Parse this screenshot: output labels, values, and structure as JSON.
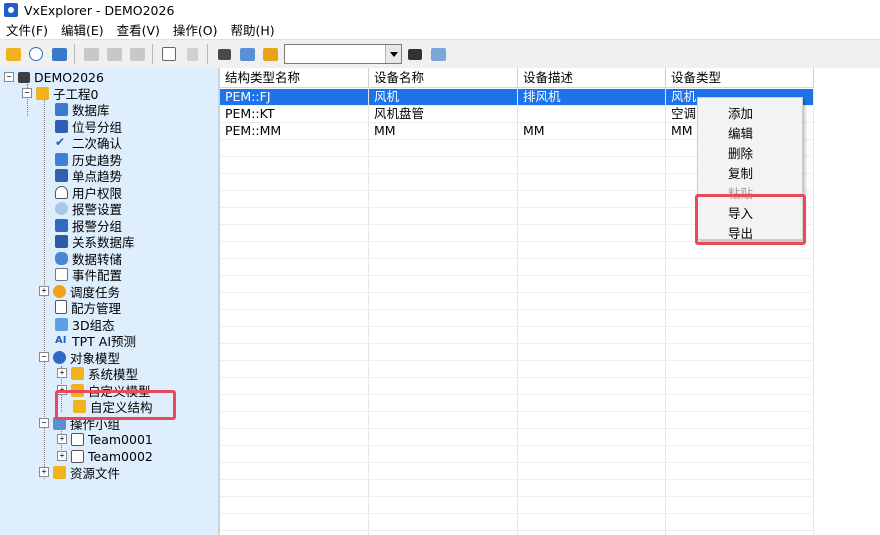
{
  "window": {
    "title": "VxExplorer - DEMO2026"
  },
  "menu": [
    "文件(F)",
    "编辑(E)",
    "查看(V)",
    "操作(O)",
    "帮助(H)"
  ],
  "toolbar": {
    "combo_value": ""
  },
  "tree": {
    "root": "DEMO2026",
    "project": "子工程0",
    "items": [
      "数据库",
      "位号分组",
      "二次确认",
      "历史趋势",
      "单点趋势",
      "用户权限",
      "报警设置",
      "报警分组",
      "关系数据库",
      "数据转储",
      "事件配置",
      "调度任务",
      "配方管理",
      "3D组态",
      "TPT AI预测",
      "对象模型"
    ],
    "object_model_children": [
      "系统模型",
      "自定义模型",
      "自定义结构"
    ],
    "op_group": "操作小组",
    "teams": [
      "Team0001",
      "Team0002"
    ],
    "resources": "资源文件"
  },
  "grid": {
    "columns": [
      "结构类型名称",
      "设备名称",
      "设备描述",
      "设备类型"
    ],
    "rows": [
      [
        "PEM::FJ",
        "风机",
        "排风机",
        "风机"
      ],
      [
        "PEM::KT",
        "风机盘管",
        "",
        "空调"
      ],
      [
        "PEM::MM",
        "MM",
        "MM",
        "MM"
      ]
    ]
  },
  "context_menu": {
    "items": [
      "添加",
      "编辑",
      "删除",
      "复制",
      "粘贴",
      "导入",
      "导出"
    ],
    "disabled": [
      "粘贴"
    ]
  },
  "colors": {
    "highlight": "#e84a5a",
    "selection": "#1e73e8",
    "tree_bg": "#dfeefc"
  }
}
